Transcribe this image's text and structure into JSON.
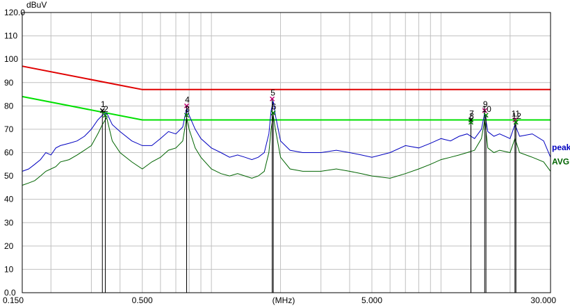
{
  "chart_data": {
    "type": "line",
    "title": "",
    "xlabel": "(MHz)",
    "ylabel": "dBuV",
    "x_scale": "log",
    "xlim": [
      0.15,
      30.0
    ],
    "ylim": [
      0.0,
      120.0
    ],
    "x_ticks": [
      {
        "value": 0.15,
        "label": "0.150"
      },
      {
        "value": 0.5,
        "label": "0.500"
      },
      {
        "value": 5.0,
        "label": "5.000"
      },
      {
        "value": 30.0,
        "label": "30.000"
      }
    ],
    "y_ticks": [
      {
        "value": 0,
        "label": "0.0"
      },
      {
        "value": 10,
        "label": "10"
      },
      {
        "value": 20,
        "label": "20"
      },
      {
        "value": 30,
        "label": "30"
      },
      {
        "value": 40,
        "label": "40"
      },
      {
        "value": 50,
        "label": "50"
      },
      {
        "value": 60,
        "label": "60"
      },
      {
        "value": 70,
        "label": "70"
      },
      {
        "value": 80,
        "label": "80"
      },
      {
        "value": 90,
        "label": "90"
      },
      {
        "value": 100,
        "label": "100"
      },
      {
        "value": 110,
        "label": "110"
      },
      {
        "value": 120,
        "label": "120.0"
      }
    ],
    "grid": true,
    "limit_lines": [
      {
        "color": "#e00000",
        "points": [
          [
            0.15,
            97
          ],
          [
            0.5,
            87
          ],
          [
            30.0,
            87
          ]
        ]
      },
      {
        "color": "#00e000",
        "points": [
          [
            0.15,
            84
          ],
          [
            0.5,
            74
          ],
          [
            30.0,
            74
          ]
        ]
      }
    ],
    "series": [
      {
        "name": "peak",
        "color": "#0000c0",
        "points": [
          [
            0.15,
            52
          ],
          [
            0.16,
            53
          ],
          [
            0.17,
            55
          ],
          [
            0.18,
            57
          ],
          [
            0.19,
            60
          ],
          [
            0.2,
            59
          ],
          [
            0.21,
            62
          ],
          [
            0.22,
            63
          ],
          [
            0.24,
            64
          ],
          [
            0.26,
            65
          ],
          [
            0.28,
            67
          ],
          [
            0.3,
            70
          ],
          [
            0.32,
            74
          ],
          [
            0.335,
            76
          ],
          [
            0.35,
            77
          ],
          [
            0.37,
            72
          ],
          [
            0.4,
            69
          ],
          [
            0.45,
            65
          ],
          [
            0.5,
            63
          ],
          [
            0.55,
            63
          ],
          [
            0.6,
            66
          ],
          [
            0.65,
            69
          ],
          [
            0.7,
            68
          ],
          [
            0.75,
            71
          ],
          [
            0.78,
            79
          ],
          [
            0.8,
            76
          ],
          [
            0.85,
            70
          ],
          [
            0.9,
            66
          ],
          [
            1.0,
            62
          ],
          [
            1.1,
            60
          ],
          [
            1.2,
            58
          ],
          [
            1.3,
            59
          ],
          [
            1.4,
            58
          ],
          [
            1.5,
            57
          ],
          [
            1.6,
            58
          ],
          [
            1.7,
            60
          ],
          [
            1.78,
            68
          ],
          [
            1.82,
            78
          ],
          [
            1.86,
            82
          ],
          [
            1.9,
            76
          ],
          [
            2.0,
            65
          ],
          [
            2.2,
            61
          ],
          [
            2.5,
            60
          ],
          [
            3.0,
            60
          ],
          [
            3.5,
            61
          ],
          [
            4.0,
            60
          ],
          [
            4.5,
            59
          ],
          [
            5.0,
            58
          ],
          [
            6.0,
            60
          ],
          [
            7.0,
            63
          ],
          [
            8.0,
            62
          ],
          [
            9.0,
            64
          ],
          [
            10.0,
            66
          ],
          [
            11.0,
            65
          ],
          [
            12.0,
            67
          ],
          [
            13.0,
            68
          ],
          [
            14.0,
            66
          ],
          [
            15.0,
            70
          ],
          [
            15.5,
            77
          ],
          [
            16.0,
            69
          ],
          [
            17.0,
            67
          ],
          [
            18.0,
            68
          ],
          [
            20.0,
            66
          ],
          [
            21.0,
            72
          ],
          [
            22.0,
            67
          ],
          [
            25.0,
            68
          ],
          [
            28.0,
            65
          ],
          [
            30.0,
            58
          ]
        ]
      },
      {
        "name": "AVG",
        "color": "#006400",
        "points": [
          [
            0.15,
            46
          ],
          [
            0.16,
            47
          ],
          [
            0.17,
            48
          ],
          [
            0.18,
            50
          ],
          [
            0.19,
            52
          ],
          [
            0.2,
            53
          ],
          [
            0.21,
            54
          ],
          [
            0.22,
            56
          ],
          [
            0.24,
            57
          ],
          [
            0.26,
            59
          ],
          [
            0.28,
            61
          ],
          [
            0.3,
            63
          ],
          [
            0.32,
            68
          ],
          [
            0.335,
            72
          ],
          [
            0.35,
            75
          ],
          [
            0.37,
            65
          ],
          [
            0.4,
            60
          ],
          [
            0.45,
            56
          ],
          [
            0.5,
            53
          ],
          [
            0.55,
            56
          ],
          [
            0.6,
            58
          ],
          [
            0.65,
            61
          ],
          [
            0.7,
            62
          ],
          [
            0.75,
            65
          ],
          [
            0.78,
            75
          ],
          [
            0.8,
            70
          ],
          [
            0.85,
            62
          ],
          [
            0.9,
            58
          ],
          [
            1.0,
            53
          ],
          [
            1.1,
            51
          ],
          [
            1.2,
            50
          ],
          [
            1.3,
            51
          ],
          [
            1.4,
            50
          ],
          [
            1.5,
            49
          ],
          [
            1.6,
            50
          ],
          [
            1.7,
            52
          ],
          [
            1.78,
            60
          ],
          [
            1.82,
            70
          ],
          [
            1.86,
            76
          ],
          [
            1.9,
            70
          ],
          [
            2.0,
            58
          ],
          [
            2.2,
            53
          ],
          [
            2.5,
            52
          ],
          [
            3.0,
            52
          ],
          [
            3.5,
            53
          ],
          [
            4.0,
            52
          ],
          [
            4.5,
            51
          ],
          [
            5.0,
            50
          ],
          [
            6.0,
            49
          ],
          [
            7.0,
            51
          ],
          [
            8.0,
            53
          ],
          [
            9.0,
            55
          ],
          [
            10.0,
            57
          ],
          [
            11.0,
            58
          ],
          [
            12.0,
            59
          ],
          [
            13.0,
            60
          ],
          [
            14.0,
            61
          ],
          [
            15.0,
            66
          ],
          [
            15.5,
            74
          ],
          [
            16.0,
            62
          ],
          [
            17.0,
            60
          ],
          [
            18.0,
            61
          ],
          [
            20.0,
            60
          ],
          [
            21.0,
            66
          ],
          [
            22.0,
            60
          ],
          [
            25.0,
            58
          ],
          [
            28.0,
            56
          ],
          [
            30.0,
            52
          ]
        ]
      }
    ],
    "markers": [
      {
        "label": "1",
        "x": 0.335,
        "y": 78,
        "color": "#000000"
      },
      {
        "label": "2",
        "x": 0.345,
        "y": 76,
        "color": "#008000"
      },
      {
        "label": "4",
        "x": 0.78,
        "y": 80,
        "color": "#c00070"
      },
      {
        "label": "3",
        "x": 0.78,
        "y": 76,
        "color": "#008000"
      },
      {
        "label": "5",
        "x": 1.84,
        "y": 83,
        "color": "#c00070"
      },
      {
        "label": "6",
        "x": 1.86,
        "y": 77,
        "color": "#008000"
      },
      {
        "label": "7",
        "x": 13.5,
        "y": 74,
        "color": "#000000"
      },
      {
        "label": "8",
        "x": 13.5,
        "y": 73,
        "color": "#008000"
      },
      {
        "label": "9",
        "x": 15.5,
        "y": 78,
        "color": "#c00070"
      },
      {
        "label": "10",
        "x": 15.7,
        "y": 76,
        "color": "#008000"
      },
      {
        "label": "11",
        "x": 21.0,
        "y": 74,
        "color": "#c00070"
      },
      {
        "label": "12",
        "x": 21.2,
        "y": 73,
        "color": "#008000"
      }
    ]
  }
}
